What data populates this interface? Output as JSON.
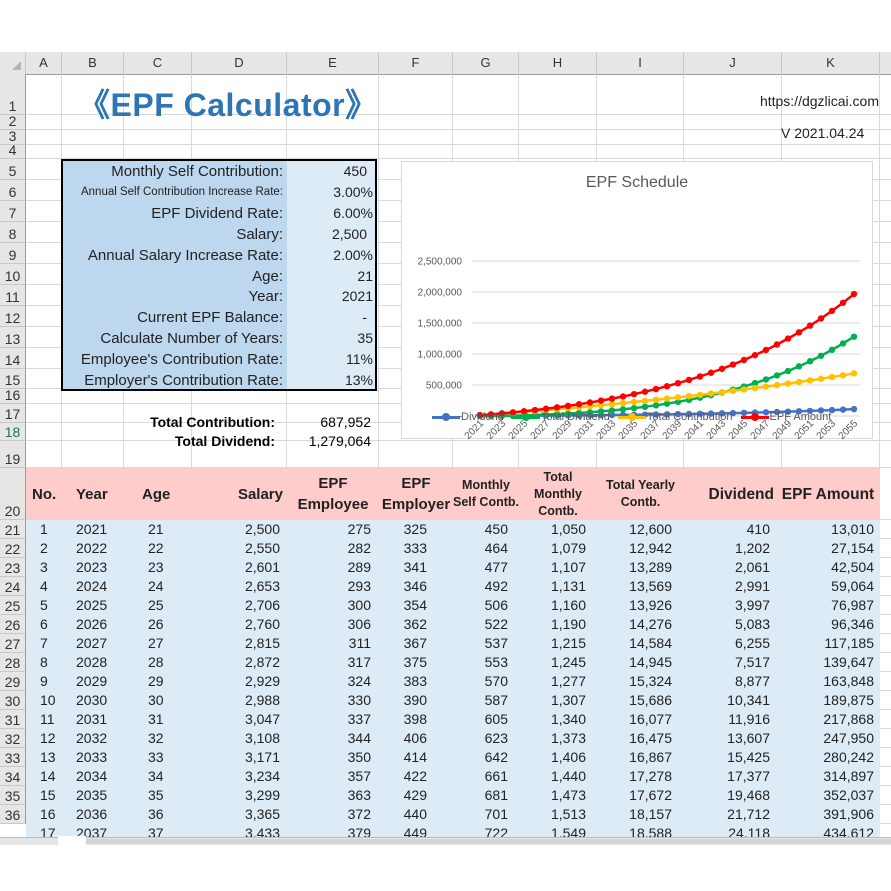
{
  "columns": [
    "A",
    "B",
    "C",
    "D",
    "E",
    "F",
    "G",
    "H",
    "I",
    "J",
    "K"
  ],
  "rows_visible": [
    "1",
    "2",
    "3",
    "4",
    "5",
    "6",
    "7",
    "8",
    "9",
    "10",
    "11",
    "12",
    "13",
    "14",
    "15",
    "16",
    "17",
    "18",
    "19",
    "20",
    "21",
    "22",
    "23",
    "24",
    "25",
    "26",
    "27",
    "28",
    "29",
    "30",
    "31",
    "32",
    "33",
    "34",
    "35",
    "36"
  ],
  "header": {
    "title": "《EPF Calculator》",
    "url": "https://dgzlicai.com",
    "version": "V 2021.04.24"
  },
  "inputs": [
    {
      "label": "Monthly Self Contribution:",
      "value": "450"
    },
    {
      "label": "Annual Self Contribution Increase Rate:",
      "value": "3.00%"
    },
    {
      "label": "EPF Dividend Rate:",
      "value": "6.00%"
    },
    {
      "label": "Salary:",
      "value": "2,500"
    },
    {
      "label": "Annual Salary Increase Rate:",
      "value": "2.00%"
    },
    {
      "label": "Age:",
      "value": "21"
    },
    {
      "label": "Year:",
      "value": "2021"
    },
    {
      "label": "Current EPF Balance:",
      "value": "-"
    },
    {
      "label": "Calculate Number of Years:",
      "value": "35"
    },
    {
      "label": "Employee's Contribution Rate:",
      "value": "11%"
    },
    {
      "label": "Employer's Contribution Rate:",
      "value": "13%"
    }
  ],
  "totals": {
    "contribution_label": "Total Contribution:",
    "contribution_value": "687,952",
    "dividend_label": "Total Dividend:",
    "dividend_value": "1,279,064"
  },
  "table": {
    "headers": [
      "No.",
      "Year",
      "Age",
      "Salary",
      "EPF Employee",
      "EPF Employer",
      "Monthly Self Contb.",
      "Total Monthly Contb.",
      "Total Yearly Contb.",
      "Dividend",
      "EPF Amount"
    ],
    "rows": [
      [
        "1",
        "2021",
        "21",
        "2,500",
        "275",
        "325",
        "450",
        "1,050",
        "12,600",
        "410",
        "13,010"
      ],
      [
        "2",
        "2022",
        "22",
        "2,550",
        "282",
        "333",
        "464",
        "1,079",
        "12,942",
        "1,202",
        "27,154"
      ],
      [
        "3",
        "2023",
        "23",
        "2,601",
        "289",
        "341",
        "477",
        "1,107",
        "13,289",
        "2,061",
        "42,504"
      ],
      [
        "4",
        "2024",
        "24",
        "2,653",
        "293",
        "346",
        "492",
        "1,131",
        "13,569",
        "2,991",
        "59,064"
      ],
      [
        "5",
        "2025",
        "25",
        "2,706",
        "300",
        "354",
        "506",
        "1,160",
        "13,926",
        "3,997",
        "76,987"
      ],
      [
        "6",
        "2026",
        "26",
        "2,760",
        "306",
        "362",
        "522",
        "1,190",
        "14,276",
        "5,083",
        "96,346"
      ],
      [
        "7",
        "2027",
        "27",
        "2,815",
        "311",
        "367",
        "537",
        "1,215",
        "14,584",
        "6,255",
        "117,185"
      ],
      [
        "8",
        "2028",
        "28",
        "2,872",
        "317",
        "375",
        "553",
        "1,245",
        "14,945",
        "7,517",
        "139,647"
      ],
      [
        "9",
        "2029",
        "29",
        "2,929",
        "324",
        "383",
        "570",
        "1,277",
        "15,324",
        "8,877",
        "163,848"
      ],
      [
        "10",
        "2030",
        "30",
        "2,988",
        "330",
        "390",
        "587",
        "1,307",
        "15,686",
        "10,341",
        "189,875"
      ],
      [
        "11",
        "2031",
        "31",
        "3,047",
        "337",
        "398",
        "605",
        "1,340",
        "16,077",
        "11,916",
        "217,868"
      ],
      [
        "12",
        "2032",
        "32",
        "3,108",
        "344",
        "406",
        "623",
        "1,373",
        "16,475",
        "13,607",
        "247,950"
      ],
      [
        "13",
        "2033",
        "33",
        "3,171",
        "350",
        "414",
        "642",
        "1,406",
        "16,867",
        "15,425",
        "280,242"
      ],
      [
        "14",
        "2034",
        "34",
        "3,234",
        "357",
        "422",
        "661",
        "1,440",
        "17,278",
        "17,377",
        "314,897"
      ],
      [
        "15",
        "2035",
        "35",
        "3,299",
        "363",
        "429",
        "681",
        "1,473",
        "17,672",
        "19,468",
        "352,037"
      ],
      [
        "16",
        "2036",
        "36",
        "3,365",
        "372",
        "440",
        "701",
        "1,513",
        "18,157",
        "21,712",
        "391,906"
      ],
      [
        "17",
        "2037",
        "37",
        "3,433",
        "379",
        "449",
        "722",
        "1,549",
        "18,588",
        "24,118",
        "434,612"
      ]
    ]
  },
  "chart_data": {
    "type": "line",
    "title": "EPF Schedule",
    "xlabel": "",
    "ylabel": "",
    "x": [
      2021,
      2022,
      2023,
      2024,
      2025,
      2026,
      2027,
      2028,
      2029,
      2030,
      2031,
      2032,
      2033,
      2034,
      2035,
      2036,
      2037,
      2038,
      2039,
      2040,
      2041,
      2042,
      2043,
      2044,
      2045,
      2046,
      2047,
      2048,
      2049,
      2050,
      2051,
      2052,
      2053,
      2054,
      2055
    ],
    "x_tick_labels": [
      "2021",
      "2023",
      "2025",
      "2027",
      "2029",
      "2031",
      "2033",
      "2035",
      "2037",
      "2039",
      "2041",
      "2043",
      "2045",
      "2047",
      "2049",
      "2051",
      "2053",
      "2055"
    ],
    "y_tick_labels": [
      "-",
      "500,000",
      "1,000,000",
      "1,500,000",
      "2,000,000",
      "2,500,000"
    ],
    "ylim": [
      0,
      2500000
    ],
    "grid": true,
    "legend": "bottom",
    "series": [
      {
        "name": "Dividend",
        "color": "#4472c4",
        "values": [
          410,
          1202,
          2061,
          2991,
          3997,
          5083,
          6255,
          7517,
          8877,
          10341,
          11916,
          13607,
          15425,
          17377,
          19468,
          21712,
          24118,
          26700,
          29460,
          32420,
          35590,
          38980,
          42600,
          46470,
          50610,
          55030,
          59750,
          64790,
          70170,
          75910,
          82040,
          88570,
          95540,
          102970,
          110890
        ]
      },
      {
        "name": "Total Dividend",
        "color": "#00b050",
        "values": [
          410,
          1612,
          3673,
          6664,
          10661,
          15744,
          21999,
          29516,
          38393,
          48734,
          60650,
          74257,
          89682,
          107059,
          126527,
          148239,
          172357,
          199057,
          228517,
          260937,
          296527,
          335507,
          378107,
          424577,
          475187,
          530217,
          589967,
          654757,
          724927,
          800837,
          882877,
          971447,
          1066987,
          1169957,
          1279064
        ]
      },
      {
        "name": "Total Contribution",
        "color": "#ffc000",
        "values": [
          12600,
          25542,
          38831,
          52400,
          66326,
          80602,
          95186,
          110131,
          125455,
          141141,
          157218,
          173693,
          190560,
          207838,
          225510,
          243667,
          262255,
          281290,
          300780,
          320740,
          341180,
          362110,
          383540,
          405490,
          427960,
          450970,
          474540,
          498670,
          523380,
          548680,
          574590,
          601120,
          628280,
          656100,
          687952
        ]
      },
      {
        "name": "EPF Amount",
        "color": "#ff0000",
        "values": [
          13010,
          27154,
          42504,
          59064,
          76987,
          96346,
          117185,
          139647,
          163848,
          189875,
          217868,
          247950,
          280242,
          314897,
          352037,
          391906,
          434612,
          480347,
          529297,
          581677,
          637707,
          697617,
          761647,
          830067,
          903147,
          981187,
          1064507,
          1153427,
          1248307,
          1349517,
          1457467,
          1572567,
          1695267,
          1826057,
          1967016
        ]
      }
    ]
  }
}
